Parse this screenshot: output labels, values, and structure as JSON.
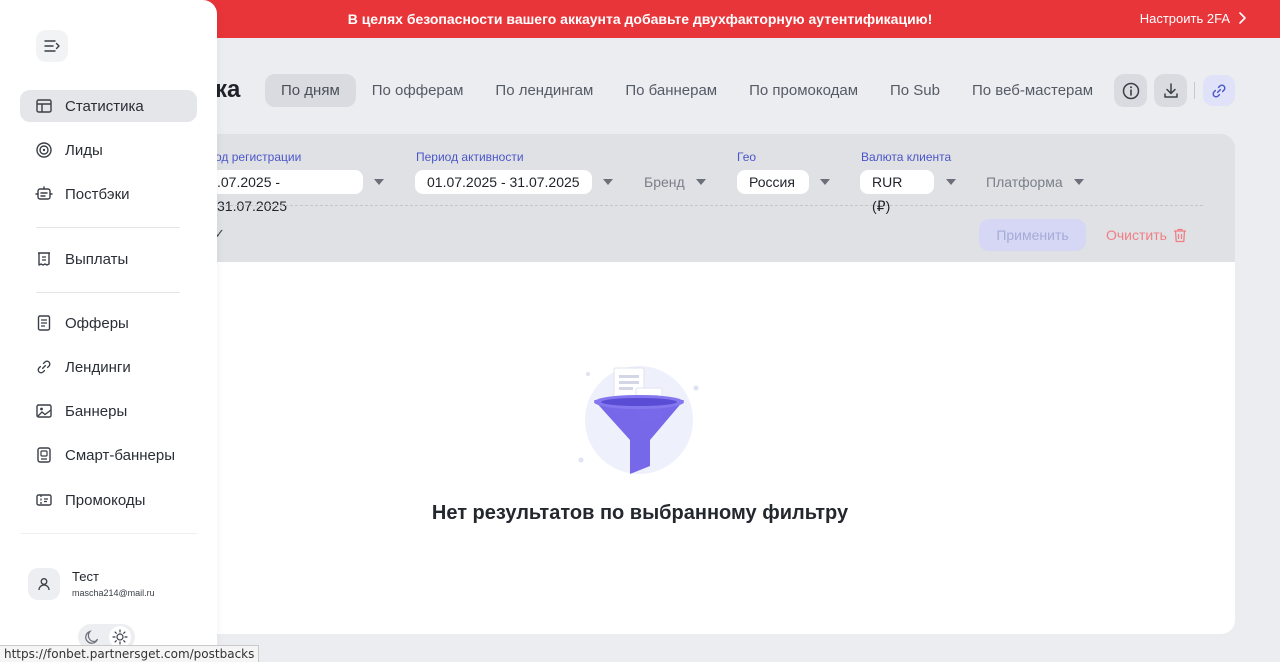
{
  "banner": {
    "message": "В целях безопасности вашего аккаунта добавьте двухфакторную аутентификацию!",
    "action": "Настроить 2FA",
    "color": "#e8353a"
  },
  "page": {
    "title_visible": "ка"
  },
  "tabs": [
    {
      "label": "По дням",
      "active": true
    },
    {
      "label": "По офферам"
    },
    {
      "label": "По лендингам"
    },
    {
      "label": "По баннерам"
    },
    {
      "label": "По промокодам"
    },
    {
      "label": "По Sub"
    },
    {
      "label": "По веб-мастерам"
    }
  ],
  "header_buttons": [
    "info-icon",
    "download-icon",
    "link-icon"
  ],
  "filters": {
    "registration": {
      "label": "од регистрации",
      "value": ".07.2025 - 31.07.2025"
    },
    "activity": {
      "label": "Период активности",
      "value": "01.07.2025 - 31.07.2025"
    },
    "brand": {
      "placeholder": "Бренд"
    },
    "geo": {
      "label": "Гео",
      "value": "Россия"
    },
    "currency": {
      "label": "Валюта клиента",
      "value": "RUR (₽)"
    },
    "platform": {
      "placeholder": "Платформа"
    },
    "checkmark": "✓",
    "apply": "Применить",
    "clear": "Очистить"
  },
  "empty_state": {
    "message": "Нет результатов по выбранному фильтру"
  },
  "sidebar": {
    "items": [
      {
        "label": "Статистика",
        "icon": "table-icon",
        "active": true
      },
      {
        "label": "Лиды",
        "icon": "target-icon"
      },
      {
        "label": "Постбэки",
        "icon": "postback-icon"
      },
      {
        "label": "Выплаты",
        "icon": "receipt-icon"
      },
      {
        "label": "Офферы",
        "icon": "document-icon"
      },
      {
        "label": "Лендинги",
        "icon": "link-icon"
      },
      {
        "label": "Баннеры",
        "icon": "image-icon"
      },
      {
        "label": "Смарт-баннеры",
        "icon": "smart-banner-icon"
      },
      {
        "label": "Промокоды",
        "icon": "promo-icon"
      }
    ],
    "user": {
      "name": "Тест",
      "email": "mascha214@mail.ru"
    }
  },
  "status_url": "https://fonbet.partnersget.com/postbacks",
  "colors": {
    "accent": "#4c56c9",
    "danger": "#e8353a",
    "funnel": "#6b5ce7"
  }
}
